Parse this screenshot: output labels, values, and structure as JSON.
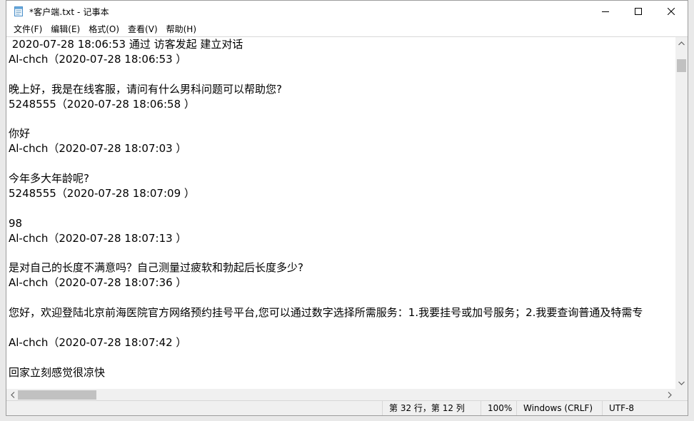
{
  "window": {
    "title": "*客户端.txt - 记事本"
  },
  "menu": [
    {
      "label": "文件(F)"
    },
    {
      "label": "编辑(E)"
    },
    {
      "label": "格式(O)"
    },
    {
      "label": "查看(V)"
    },
    {
      "label": "帮助(H)"
    }
  ],
  "document": {
    "lines": [
      " 2020-07-28 18:06:53 通过 访客发起 建立对话",
      "Al-chch（2020-07-28 18:06:53 ）",
      "",
      "晚上好，我是在线客服，请问有什么男科问题可以帮助您?",
      "5248555（2020-07-28 18:06:58 ）",
      "",
      "你好",
      "Al-chch（2020-07-28 18:07:03 ）",
      "",
      "今年多大年龄呢?",
      "5248555（2020-07-28 18:07:09 ）",
      "",
      "98",
      "Al-chch（2020-07-28 18:07:13 ）",
      "",
      "是对自己的长度不满意吗？自己测量过疲软和勃起后长度多少?",
      "Al-chch（2020-07-28 18:07:36 ）",
      "",
      "您好，欢迎登陆北京前海医院官方网络预约挂号平台,您可以通过数字选择所需服务：1.我要挂号或加号服务；2.我要查询普通及特需专",
      "",
      "Al-chch（2020-07-28 18:07:42 ）",
      "",
      "回家立刻感觉很凉快"
    ]
  },
  "status": {
    "position": "第 32 行，第 12 列",
    "zoom": "100%",
    "line_ending": "Windows (CRLF)",
    "encoding": "UTF-8"
  },
  "icons": {
    "app": "notepad-icon",
    "minimize": "minimize-icon",
    "maximize": "maximize-icon",
    "close": "close-icon"
  }
}
